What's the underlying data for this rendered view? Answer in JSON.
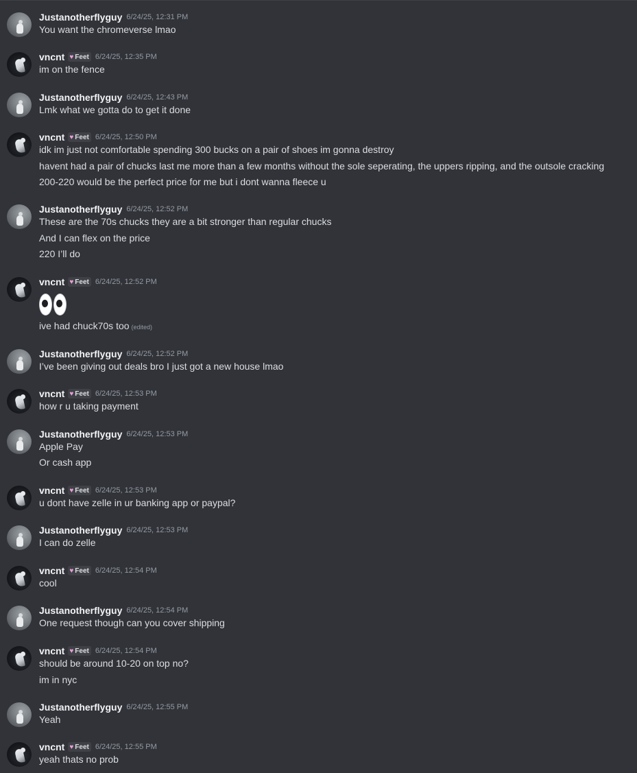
{
  "messages": [
    {
      "user": "Justanotherflyguy",
      "avatar": "grey-figure-avatar",
      "time": "6/24/25, 12:31 PM",
      "lines": [
        "You want the chromeverse lmao"
      ]
    },
    {
      "user": "vncnt",
      "avatar": "dark-figure-avatar",
      "tag": "Feet",
      "time": "6/24/25, 12:35 PM",
      "lines": [
        "im on the fence"
      ]
    },
    {
      "user": "Justanotherflyguy",
      "avatar": "grey-figure-avatar",
      "time": "6/24/25, 12:43 PM",
      "lines": [
        "Lmk what we gotta do to get it done"
      ]
    },
    {
      "user": "vncnt",
      "avatar": "dark-figure-avatar",
      "tag": "Feet",
      "time": "6/24/25, 12:50 PM",
      "lines": [
        "idk im just not comfortable spending 300 bucks on a pair of shoes im gonna destroy",
        "havent had a pair of chucks last me more than a few months without the sole seperating, the uppers ripping, and the outsole cracking",
        "200-220 would be the perfect price for me but i dont wanna fleece u"
      ]
    },
    {
      "user": "Justanotherflyguy",
      "avatar": "grey-figure-avatar",
      "time": "6/24/25, 12:52 PM",
      "lines": [
        "These are the 70s chucks they are a bit stronger than regular chucks",
        "And I can flex on the price",
        "220 I’ll do"
      ]
    },
    {
      "user": "vncnt",
      "avatar": "dark-figure-avatar",
      "tag": "Feet",
      "time": "6/24/25, 12:52 PM",
      "emoji": "eyes-emoji",
      "lines": [
        "ive had chuck70s too"
      ],
      "edited": "(edited)"
    },
    {
      "user": "Justanotherflyguy",
      "avatar": "grey-figure-avatar",
      "time": "6/24/25, 12:52 PM",
      "lines": [
        "I’ve been giving out deals bro I just got a new house lmao"
      ]
    },
    {
      "user": "vncnt",
      "avatar": "dark-figure-avatar",
      "tag": "Feet",
      "time": "6/24/25, 12:53 PM",
      "lines": [
        "how r u taking payment"
      ]
    },
    {
      "user": "Justanotherflyguy",
      "avatar": "grey-figure-avatar",
      "time": "6/24/25, 12:53 PM",
      "lines": [
        "Apple Pay",
        "Or cash app"
      ]
    },
    {
      "user": "vncnt",
      "avatar": "dark-figure-avatar",
      "tag": "Feet",
      "time": "6/24/25, 12:53 PM",
      "lines": [
        "u dont have zelle in ur banking app or paypal?"
      ]
    },
    {
      "user": "Justanotherflyguy",
      "avatar": "grey-figure-avatar",
      "time": "6/24/25, 12:53 PM",
      "lines": [
        "I can do zelle"
      ]
    },
    {
      "user": "vncnt",
      "avatar": "dark-figure-avatar",
      "tag": "Feet",
      "time": "6/24/25, 12:54 PM",
      "lines": [
        "cool"
      ]
    },
    {
      "user": "Justanotherflyguy",
      "avatar": "grey-figure-avatar",
      "time": "6/24/25, 12:54 PM",
      "lines": [
        "One request though can you cover shipping"
      ]
    },
    {
      "user": "vncnt",
      "avatar": "dark-figure-avatar",
      "tag": "Feet",
      "time": "6/24/25, 12:54 PM",
      "lines": [
        "should be around 10-20 on top no?",
        "im in nyc"
      ]
    },
    {
      "user": "Justanotherflyguy",
      "avatar": "grey-figure-avatar",
      "time": "6/24/25, 12:55 PM",
      "lines": [
        "Yeah"
      ]
    },
    {
      "user": "vncnt",
      "avatar": "dark-figure-avatar",
      "tag": "Feet",
      "time": "6/24/25, 12:55 PM",
      "lines": [
        "yeah thats no prob"
      ]
    }
  ]
}
